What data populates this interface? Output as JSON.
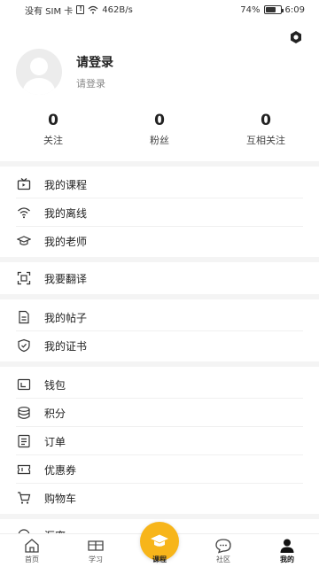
{
  "status_bar": {
    "carrier": "没有 SIM 卡",
    "speed": "462B/s",
    "battery": "74%",
    "battery_level": 0.74,
    "time": "6:09"
  },
  "profile": {
    "name": "请登录",
    "subtitle": "请登录"
  },
  "stats": [
    {
      "value": "0",
      "label": "关注"
    },
    {
      "value": "0",
      "label": "粉丝"
    },
    {
      "value": "0",
      "label": "互相关注"
    }
  ],
  "menu": {
    "courses": "我的课程",
    "offline": "我的离线",
    "teachers": "我的老师",
    "translate": "我要翻译",
    "posts": "我的帖子",
    "certificates": "我的证书",
    "wallet": "钱包",
    "points": "积分",
    "orders": "订单",
    "coupons": "优惠券",
    "cart": "购物车",
    "partial": "汇率"
  },
  "tabs": {
    "home": "首页",
    "study": "学习",
    "course": "课程",
    "community": "社区",
    "mine": "我的"
  },
  "colors": {
    "accent": "#f7b51a",
    "text": "#222222",
    "muted": "#888888",
    "section_gap": "#f4f4f4"
  },
  "icons": {
    "settings": "hexagon-settings-icon",
    "courses": "tv-icon",
    "offline": "wifi-icon",
    "teachers": "graduation-cap-icon",
    "translate": "scan-translate-icon",
    "posts": "document-icon",
    "certificates": "shield-badge-icon",
    "wallet": "wallet-icon",
    "points": "coins-stack-icon",
    "orders": "list-document-icon",
    "coupons": "ticket-icon",
    "cart": "cart-icon"
  }
}
